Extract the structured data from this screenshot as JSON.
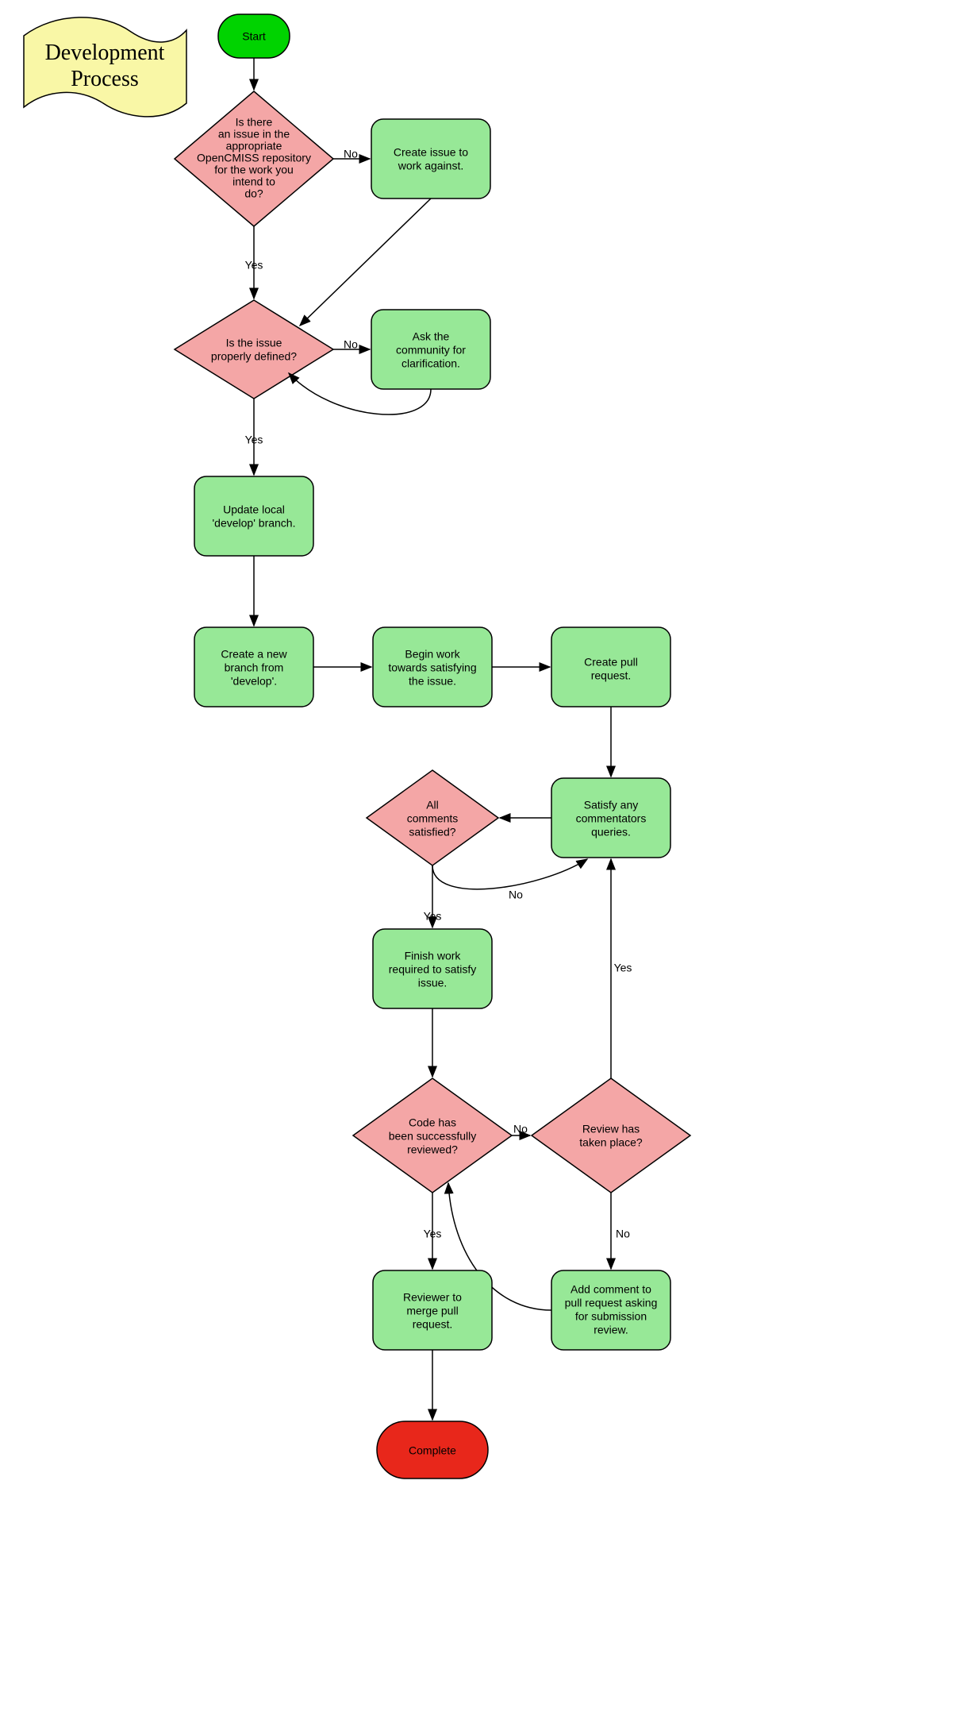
{
  "title": {
    "line1": "Development",
    "line2": "Process"
  },
  "nodes": {
    "start": "Start",
    "issueExists": "Is there an  issue in the appropriate OpenCMISS repository for the work you intend to do?",
    "createIssue": "Create issue to work against.",
    "issueDefined": "Is the issue properly defined?",
    "askCommunity": "Ask the community for clarification.",
    "updateLocal": "Update local 'develop' branch.",
    "createBranch": "Create a new branch from 'develop'.",
    "beginWork": "Begin work towards satisfying the issue.",
    "createPR": "Create pull request.",
    "satisfyQueries": "Satisfy any commentators queries.",
    "allComments": "All comments satisfied?",
    "finishWork": "Finish work required to satisfy issue.",
    "codeReviewed": "Code has been successfully reviewed?",
    "reviewTakenPlace": "Review has taken place?",
    "reviewerMerge": "Reviewer to merge pull request.",
    "addComment": "Add comment to pull request asking for submission review.",
    "complete": "Complete"
  },
  "labels": {
    "yes": "Yes",
    "no": "No"
  },
  "colors": {
    "start": "#00d300",
    "process": "#97e897",
    "decision": "#f4a6a6",
    "end": "#e8271b",
    "title_bg": "#f9f7a6"
  }
}
